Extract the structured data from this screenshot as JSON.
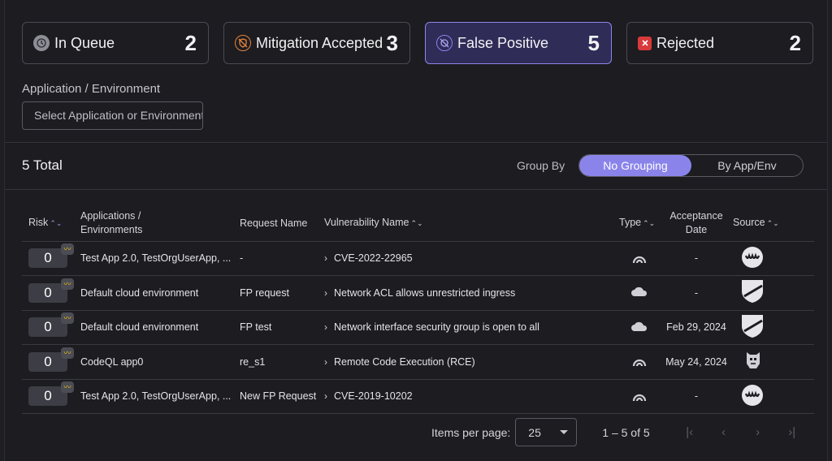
{
  "cards": [
    {
      "label": "In Queue",
      "count": "2",
      "icon": "clock-icon",
      "color": "#8e8e96",
      "active": false
    },
    {
      "label": "Mitigation Accepted",
      "count": "3",
      "icon": "shield-slash-icon",
      "color": "#e8843a",
      "active": false
    },
    {
      "label": "False Positive",
      "count": "5",
      "icon": "badge-slash-icon",
      "color": "#8a84ea",
      "active": true
    },
    {
      "label": "Rejected",
      "count": "2",
      "icon": "x-square-icon",
      "color": "#d8393a",
      "active": false
    }
  ],
  "filter": {
    "label": "Application / Environment",
    "placeholder": "Select Application or Environment"
  },
  "summary": {
    "total": "5 Total"
  },
  "group_by": {
    "label": "Group By",
    "options": [
      "No Grouping",
      "By App/Env"
    ],
    "selected": "No Grouping"
  },
  "table": {
    "headers": {
      "risk": "Risk",
      "apps": "Applications / Environments",
      "request": "Request Name",
      "vuln": "Vulnerability Name",
      "type": "Type",
      "date": "Acceptance Date",
      "source": "Source"
    },
    "rows": [
      {
        "risk": "0",
        "apps": "Test App 2.0, TestOrgUserApp, ...",
        "request": "-",
        "vuln": "CVE-2022-22965",
        "type": "code-icon",
        "date": "-",
        "source": "wave-logo-icon"
      },
      {
        "risk": "0",
        "apps": "Default cloud environment",
        "request": "FP request",
        "vuln": "Network ACL allows unrestricted ingress",
        "type": "cloud-icon",
        "date": "-",
        "source": "shield-logo-icon"
      },
      {
        "risk": "0",
        "apps": "Default cloud environment",
        "request": "FP test",
        "vuln": "Network interface security group is open to all",
        "type": "cloud-icon",
        "date": "Feb 29, 2024",
        "source": "shield-logo-icon"
      },
      {
        "risk": "0",
        "apps": "CodeQL app0",
        "request": "re_s1",
        "vuln": "Remote Code Execution (RCE)",
        "type": "code-icon",
        "date": "May 24, 2024",
        "source": "codeql-logo-icon"
      },
      {
        "risk": "0",
        "apps": "Test App 2.0, TestOrgUserApp, ...",
        "request": "New FP Request",
        "vuln": "CVE-2019-10202",
        "type": "code-icon",
        "date": "-",
        "source": "wave-logo-icon"
      }
    ]
  },
  "pagination": {
    "items_per_page_label": "Items per page:",
    "items_per_page": "25",
    "range": "1 – 5 of 5"
  }
}
